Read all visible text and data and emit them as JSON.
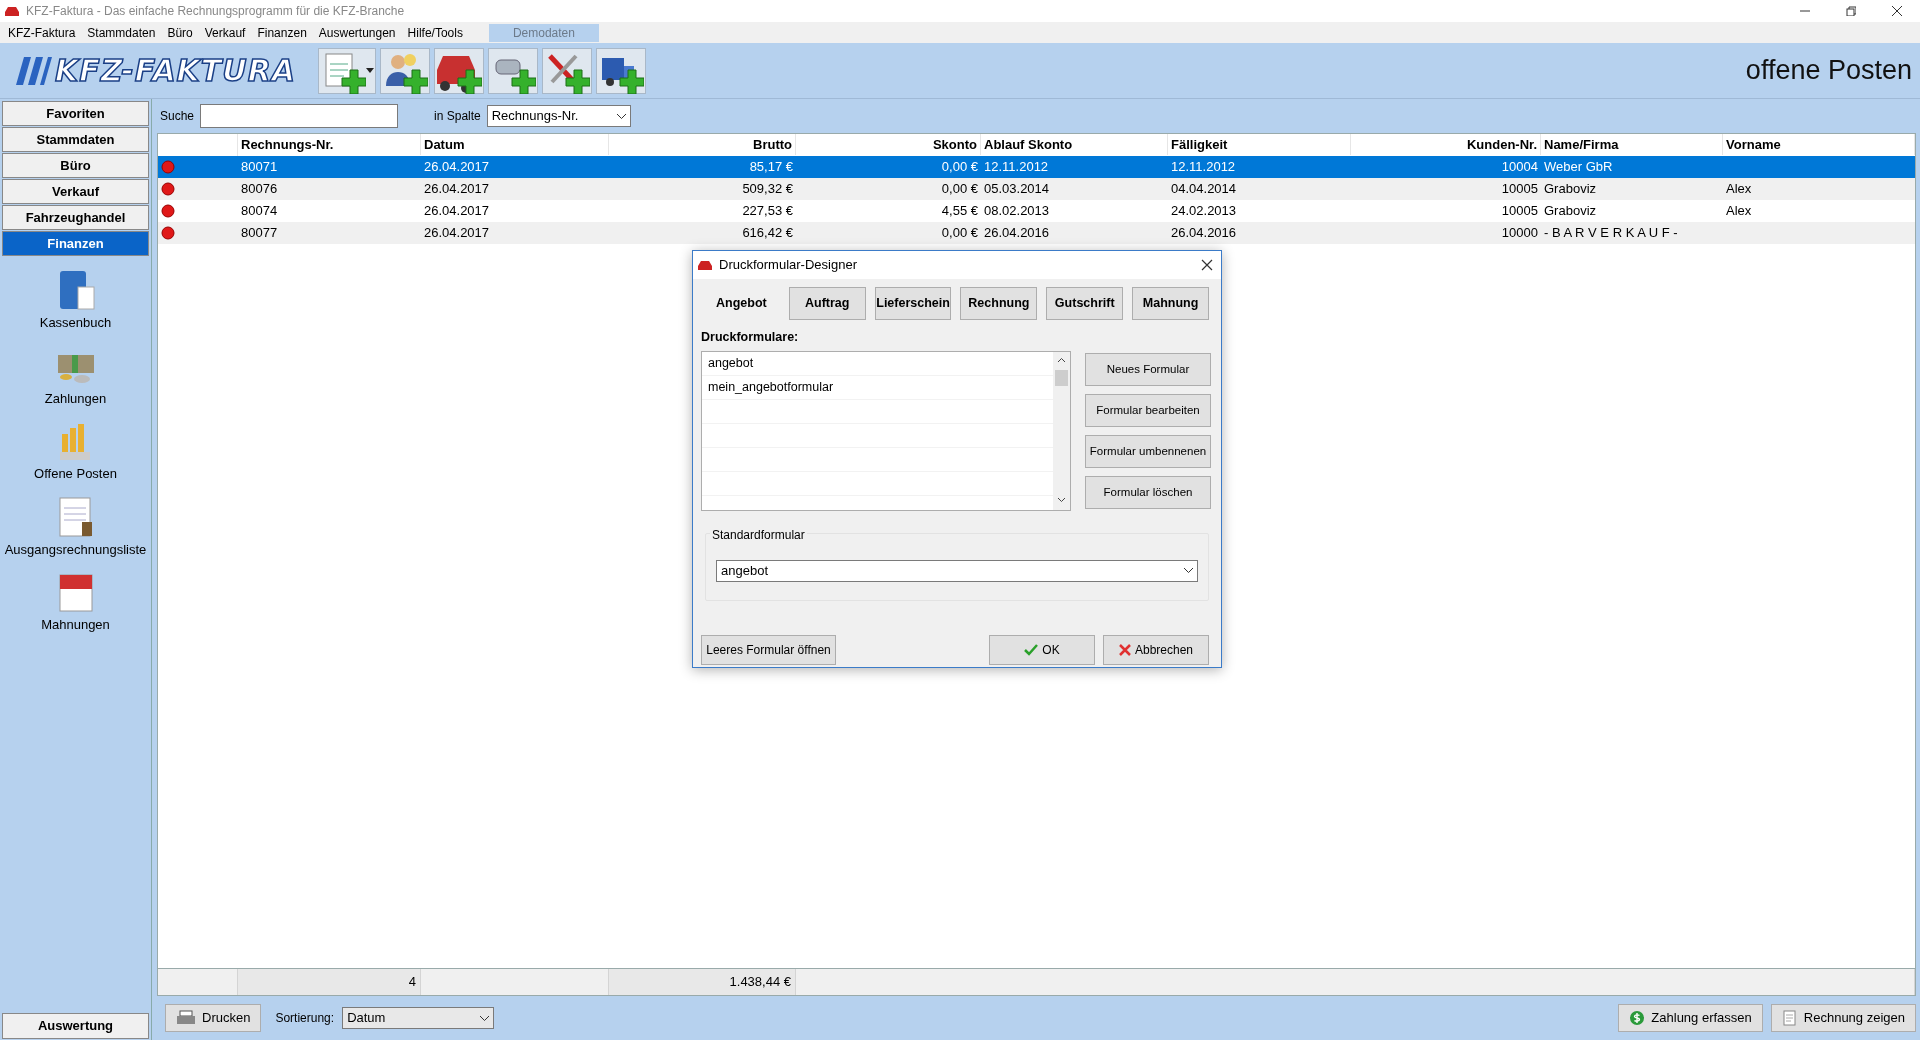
{
  "window": {
    "title": "KFZ-Faktura - Das einfache Rechnungsprogramm für die KFZ-Branche"
  },
  "menu": [
    "KFZ-Faktura",
    "Stammdaten",
    "Büro",
    "Verkauf",
    "Finanzen",
    "Auswertungen",
    "Hilfe/Tools"
  ],
  "demo_tab": "Demodaten",
  "logo": "KFZ-FAKTURA",
  "toolbar": [
    {
      "kind": "document"
    },
    {
      "kind": "people"
    },
    {
      "kind": "car"
    },
    {
      "kind": "parts"
    },
    {
      "kind": "tools"
    },
    {
      "kind": "truck"
    }
  ],
  "page_title": "offene Posten",
  "sidebar": {
    "sections": [
      {
        "label": "Favoriten",
        "selected": false
      },
      {
        "label": "Stammdaten",
        "selected": false
      },
      {
        "label": "Büro",
        "selected": false
      },
      {
        "label": "Verkauf",
        "selected": false
      },
      {
        "label": "Fahrzeughandel",
        "selected": false
      },
      {
        "label": "Finanzen",
        "selected": true
      }
    ],
    "items": [
      {
        "kind": "book",
        "label": "Kassenbuch"
      },
      {
        "kind": "money",
        "label": "Zahlungen"
      },
      {
        "kind": "coins",
        "label": "Offene Posten"
      },
      {
        "kind": "list",
        "label": "Ausgangsrechnungsliste"
      },
      {
        "kind": "calendar",
        "label": "Mahnungen"
      }
    ],
    "bottom_section": "Auswertung"
  },
  "search": {
    "label": "Suche"
  },
  "column_filter": {
    "label": "in Spalte",
    "value": "Rechnungs-Nr."
  },
  "table": {
    "columns": [
      "Rechnungs-Nr.",
      "Datum",
      "Brutto",
      "Skonto",
      "Ablauf Skonto",
      "Fälligkeit",
      "Kunden-Nr.",
      "Name/Firma",
      "Vorname"
    ],
    "rows": [
      {
        "selected": true,
        "cells": [
          "80071",
          "26.04.2017",
          "85,17 €",
          "0,00 €",
          "12.11.2012",
          "12.11.2012",
          "10004",
          "Weber GbR",
          null
        ]
      },
      {
        "selected": false,
        "cells": [
          "80076",
          "26.04.2017",
          "509,32 €",
          "0,00 €",
          "05.03.2014",
          "04.04.2014",
          "10005",
          "Graboviz",
          "Alex"
        ]
      },
      {
        "selected": false,
        "cells": [
          "80074",
          "26.04.2017",
          "227,53 €",
          "4,55 €",
          "08.02.2013",
          "24.02.2013",
          "10005",
          "Graboviz",
          "Alex"
        ]
      },
      {
        "selected": false,
        "cells": [
          "80077",
          "26.04.2017",
          "616,42 €",
          "0,00 €",
          "26.04.2016",
          "26.04.2016",
          "10000",
          "- B A R V E R K A U F -",
          null
        ]
      }
    ],
    "totals": {
      "count": "4",
      "brutto": "1.438,44 €"
    }
  },
  "bottom_bar": {
    "print": "Drucken",
    "sort_label": "Sortierung:",
    "sort_value": "Datum",
    "actions": [
      {
        "kind": "payment",
        "label": "Zahlung erfassen"
      },
      {
        "kind": "invoice",
        "label": "Rechnung zeigen"
      }
    ]
  },
  "dialog": {
    "title": "Druckformular-Designer",
    "tabs": [
      {
        "label": "Angebot",
        "selected": true
      },
      {
        "label": "Auftrag",
        "selected": false
      },
      {
        "label": "Lieferschein",
        "selected": false
      },
      {
        "label": "Rechnung",
        "selected": false
      },
      {
        "label": "Gutschrift",
        "selected": false
      },
      {
        "label": "Mahnung",
        "selected": false
      }
    ],
    "list_label": "Druckformulare:",
    "forms": [
      "angebot",
      "mein_angebotformular"
    ],
    "form_buttons": [
      "Neues Formular",
      "Formular bearbeiten",
      "Formular umbennenen",
      "Formular löschen"
    ],
    "default_label": "Standardformular",
    "default_value": "angebot",
    "open_blank": "Leeres Formular öffnen",
    "ok": "OK",
    "cancel": "Abbrechen"
  }
}
